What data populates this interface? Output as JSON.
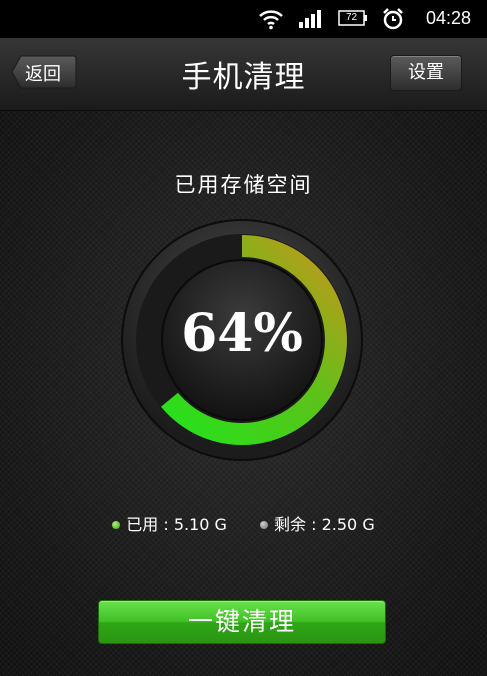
{
  "status_bar": {
    "battery_level": "72",
    "time": "04:28",
    "icons": [
      "wifi-icon",
      "signal-icon",
      "battery-icon",
      "alarm-icon"
    ]
  },
  "header": {
    "back_label": "返回",
    "title": "手机清理",
    "settings_label": "设置"
  },
  "storage": {
    "section_title": "已用存储空间",
    "percent_text": "64%",
    "used_fraction": 0.64,
    "used_label": "已用 : 5.10 G",
    "free_label": "剩余 : 2.50 G"
  },
  "actions": {
    "clean_label": "一键清理"
  },
  "colors": {
    "used_arc_start": "#1ee61b",
    "used_arc_end": "#c8961a",
    "button_green": "#3fbf25"
  }
}
